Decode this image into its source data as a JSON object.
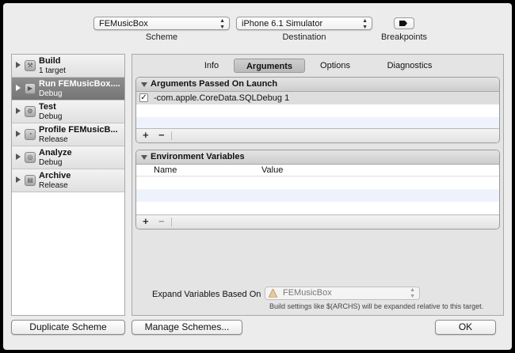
{
  "toolbar": {
    "scheme_value": "FEMusicBox",
    "scheme_caption": "Scheme",
    "destination_value": "iPhone 6.1 Simulator",
    "destination_caption": "Destination",
    "breakpoints_caption": "Breakpoints"
  },
  "sidebar": {
    "items": [
      {
        "title": "Build",
        "subtitle": "1 target",
        "icon": "hammer-icon"
      },
      {
        "title": "Run FEMusicBox....",
        "subtitle": "Debug",
        "icon": "play-icon"
      },
      {
        "title": "Test",
        "subtitle": "Debug",
        "icon": "wrench-icon"
      },
      {
        "title": "Profile FEMusicB...",
        "subtitle": "Release",
        "icon": "gauge-icon"
      },
      {
        "title": "Analyze",
        "subtitle": "Debug",
        "icon": "analyze-icon"
      },
      {
        "title": "Archive",
        "subtitle": "Release",
        "icon": "archive-icon"
      }
    ]
  },
  "tabs": [
    "Info",
    "Arguments",
    "Options",
    "Diagnostics"
  ],
  "arguments": {
    "header": "Arguments Passed On Launch",
    "rows": [
      {
        "checked": true,
        "text": "-com.apple.CoreData.SQLDebug 1"
      }
    ],
    "add": "+",
    "remove": "−"
  },
  "environment": {
    "header": "Environment Variables",
    "col_name": "Name",
    "col_value": "Value",
    "add": "+",
    "remove": "−"
  },
  "expand": {
    "label": "Expand Variables Based On",
    "value": "FEMusicBox",
    "hint": "Build settings like $(ARCHS) will be expanded relative to this target."
  },
  "buttons": {
    "duplicate": "Duplicate Scheme",
    "manage": "Manage Schemes...",
    "ok": "OK"
  }
}
